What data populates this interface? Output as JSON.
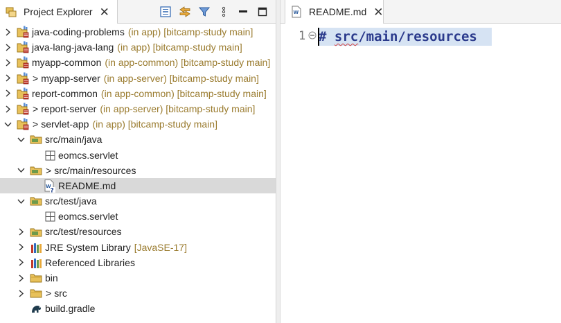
{
  "explorer": {
    "tab_title": "Project Explorer",
    "close_glyph": "✕",
    "toolbar": [
      "collapse-all-icon",
      "link-with-editor-icon",
      "filter-icon",
      "view-menu-icon",
      "minimize-icon",
      "maximize-icon"
    ]
  },
  "editor": {
    "tab_title": "README.md",
    "close_glyph": "✕",
    "line_number": "1",
    "code_hash": "#",
    "code_src": "src",
    "code_rest": "/main/resources"
  },
  "tree": [
    {
      "name": "java-coding-problems",
      "qualifier": "(in app) [bitcamp-study main]",
      "arrow": "right",
      "icon": "project-icon",
      "level": 0,
      "dirty": false
    },
    {
      "name": "java-lang-java-lang",
      "qualifier": "(in app) [bitcamp-study main]",
      "arrow": "right",
      "icon": "project-icon",
      "level": 0,
      "dirty": false
    },
    {
      "name": "myapp-common",
      "qualifier": "(in app-common) [bitcamp-study main]",
      "arrow": "right",
      "icon": "project-icon",
      "level": 0,
      "dirty": false
    },
    {
      "name": "myapp-server",
      "qualifier": "(in app-server) [bitcamp-study main]",
      "arrow": "right",
      "icon": "project-icon",
      "level": 0,
      "dirty": true
    },
    {
      "name": "report-common",
      "qualifier": "(in app-common) [bitcamp-study main]",
      "arrow": "right",
      "icon": "project-icon",
      "level": 0,
      "dirty": false
    },
    {
      "name": "report-server",
      "qualifier": "(in app-server) [bitcamp-study main]",
      "arrow": "right",
      "icon": "project-icon",
      "level": 0,
      "dirty": true
    },
    {
      "name": "servlet-app",
      "qualifier": "(in app) [bitcamp-study main]",
      "arrow": "down",
      "icon": "project-icon",
      "level": 0,
      "dirty": true
    },
    {
      "name": "src/main/java",
      "qualifier": "",
      "arrow": "down",
      "icon": "source-folder-icon",
      "level": 1,
      "dirty": false
    },
    {
      "name": "eomcs.servlet",
      "qualifier": "",
      "arrow": "none",
      "icon": "package-icon",
      "level": 2,
      "dirty": false
    },
    {
      "name": "src/main/resources",
      "qualifier": "",
      "arrow": "down",
      "icon": "source-folder-icon",
      "level": 1,
      "dirty": true
    },
    {
      "name": "README.md",
      "qualifier": "",
      "arrow": "none",
      "icon": "markdown-file-icon",
      "level": 2,
      "dirty": false,
      "selected": true
    },
    {
      "name": "src/test/java",
      "qualifier": "",
      "arrow": "down",
      "icon": "source-folder-icon",
      "level": 1,
      "dirty": false
    },
    {
      "name": "eomcs.servlet",
      "qualifier": "",
      "arrow": "none",
      "icon": "package-icon",
      "level": 2,
      "dirty": false
    },
    {
      "name": "src/test/resources",
      "qualifier": "",
      "arrow": "right",
      "icon": "source-folder-icon",
      "level": 1,
      "dirty": false
    },
    {
      "name": "JRE System Library",
      "qualifier": "[JavaSE-17]",
      "arrow": "right",
      "icon": "library-icon",
      "level": 1,
      "dirty": false
    },
    {
      "name": "Referenced Libraries",
      "qualifier": "",
      "arrow": "right",
      "icon": "library-icon",
      "level": 1,
      "dirty": false
    },
    {
      "name": "bin",
      "qualifier": "",
      "arrow": "right",
      "icon": "folder-icon",
      "level": 1,
      "dirty": false
    },
    {
      "name": "src",
      "qualifier": "",
      "arrow": "right",
      "icon": "folder-icon",
      "level": 1,
      "dirty": true
    },
    {
      "name": "build.gradle",
      "qualifier": "",
      "arrow": "none",
      "icon": "gradle-file-icon",
      "level": 1,
      "dirty": false
    }
  ],
  "dirty_marker": ">"
}
